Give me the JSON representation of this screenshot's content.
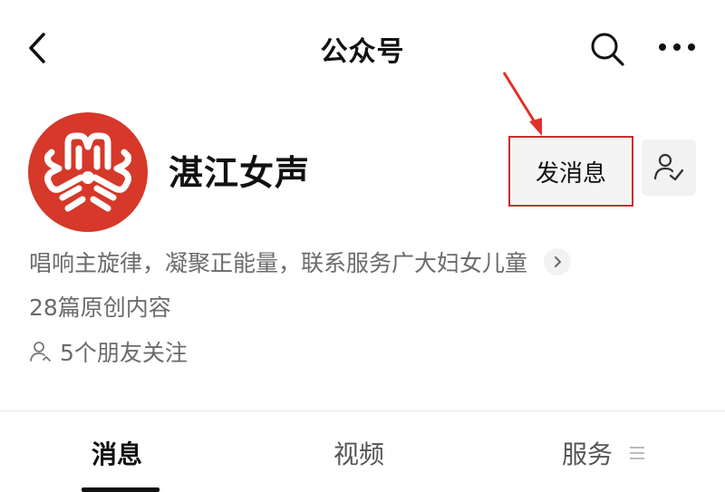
{
  "header": {
    "title": "公众号"
  },
  "account": {
    "name": "湛江女声",
    "message_button": "发消息",
    "description": "唱响主旋律，凝聚正能量，联系服务广大妇女儿童",
    "originals": "28篇原创内容",
    "friends_following": "5个朋友关注"
  },
  "tabs": [
    {
      "label": "消息",
      "active": true
    },
    {
      "label": "视频",
      "active": false
    },
    {
      "label": "服务",
      "active": false
    }
  ],
  "colors": {
    "logo_red": "#d6382a",
    "highlight_red": "#c8302a",
    "annotation_arrow": "#e2302a"
  },
  "icons": {
    "back": "chevron-left-icon",
    "search": "search-icon",
    "more": "more-dots-icon",
    "follow": "user-check-icon",
    "expand": "chevron-right-icon",
    "friends": "user-outline-icon",
    "service_menu": "menu-lines-icon"
  }
}
